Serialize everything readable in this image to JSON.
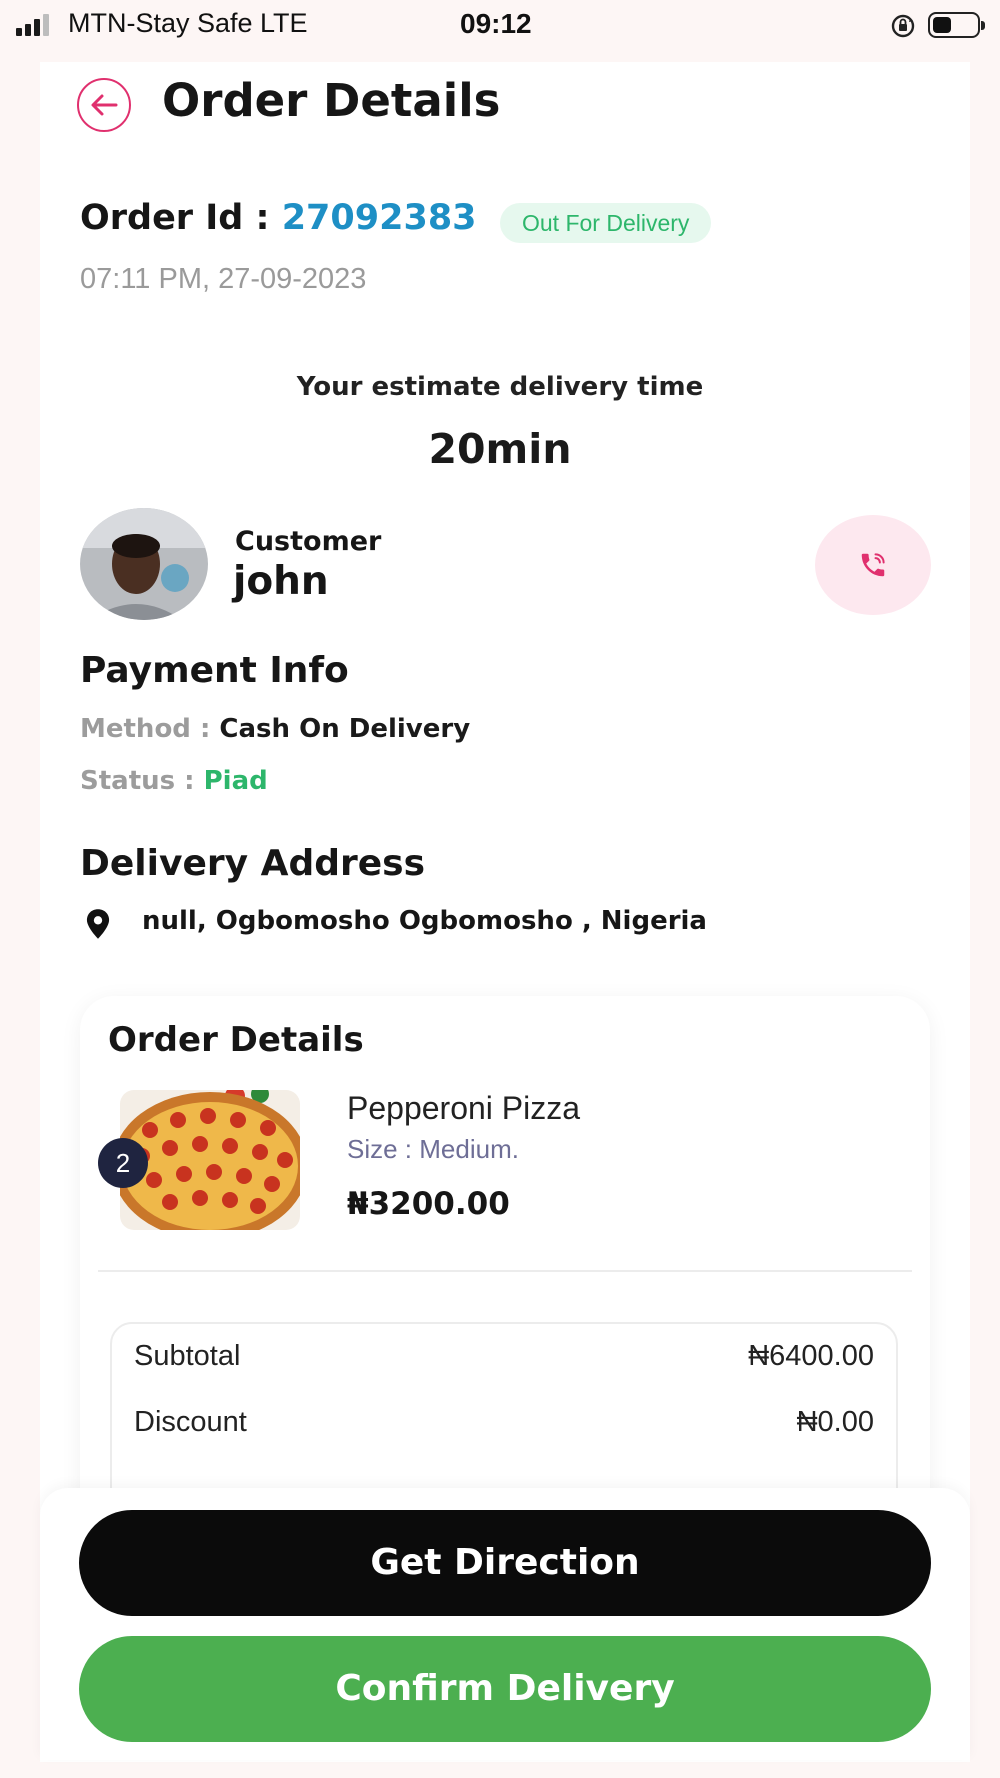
{
  "status_bar": {
    "carrier": "MTN-Stay Safe  LTE",
    "time": "09:12"
  },
  "header": {
    "title": "Order Details"
  },
  "order": {
    "id_label": "Order Id : ",
    "id_value": "27092383",
    "status": "Out For Delivery",
    "datetime": "07:11 PM, 27-09-2023"
  },
  "estimate": {
    "label": "Your estimate delivery time",
    "value": "20min"
  },
  "customer": {
    "label": "Customer",
    "name": "john"
  },
  "payment": {
    "title": "Payment Info",
    "method_key": "Method : ",
    "method_value": "Cash On Delivery",
    "status_key": "Status : ",
    "status_value": "Piad"
  },
  "delivery": {
    "title": "Delivery Address",
    "address": "null, Ogbomosho Ogbomosho , Nigeria"
  },
  "order_details": {
    "title": "Order Details",
    "items": [
      {
        "quantity": "2",
        "name": "Pepperoni Pizza",
        "size": "Size : Medium.",
        "price": "₦3200.00"
      }
    ],
    "summary": {
      "subtotal_label": "Subtotal",
      "subtotal_value": "₦6400.00",
      "discount_label": "Discount",
      "discount_value": "₦0.00"
    }
  },
  "actions": {
    "direction_label": "Get Direction",
    "confirm_label": "Confirm Delivery"
  },
  "colors": {
    "accent_pink": "#e0306e",
    "order_id_blue": "#1e8fc5",
    "success_green": "#2db66b",
    "confirm_button": "#4caf50",
    "direction_button": "#0b0b0b"
  },
  "icons": {
    "back": "arrow-left-icon",
    "call": "phone-icon",
    "location": "location-pin-icon",
    "battery": "battery-icon",
    "signal": "signal-icon",
    "rotation_lock": "rotation-lock-icon"
  }
}
